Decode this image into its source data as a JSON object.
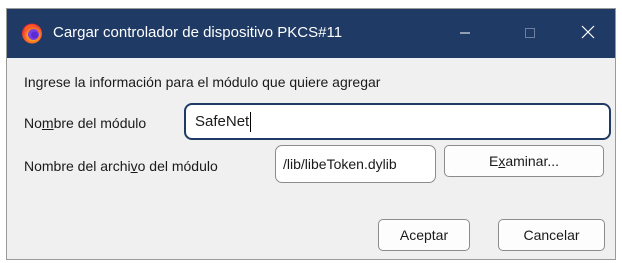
{
  "window": {
    "title": "Cargar controlador de dispositivo PKCS#11",
    "icon": "firefox-icon",
    "controls": {
      "minimize_icon": "minimize-icon",
      "maximize_icon": "maximize-icon",
      "close_icon": "close-icon"
    },
    "colors": {
      "titlebar": "#1f3a64",
      "body": "#f0f0f0"
    }
  },
  "form": {
    "intro": "Ingrese la información para el módulo que quiere agregar",
    "module_name": {
      "label_pre": "No",
      "label_key": "m",
      "label_post": "bre del módulo",
      "value": "SafeNet"
    },
    "module_file": {
      "label_pre": "Nombre del archi",
      "label_key": "v",
      "label_post": "o del módulo",
      "value": "/lib/libeToken.dylib"
    },
    "browse": {
      "label_pre": "E",
      "label_key": "x",
      "label_post": "aminar..."
    }
  },
  "footer": {
    "ok_label": "Aceptar",
    "cancel_label": "Cancelar"
  }
}
